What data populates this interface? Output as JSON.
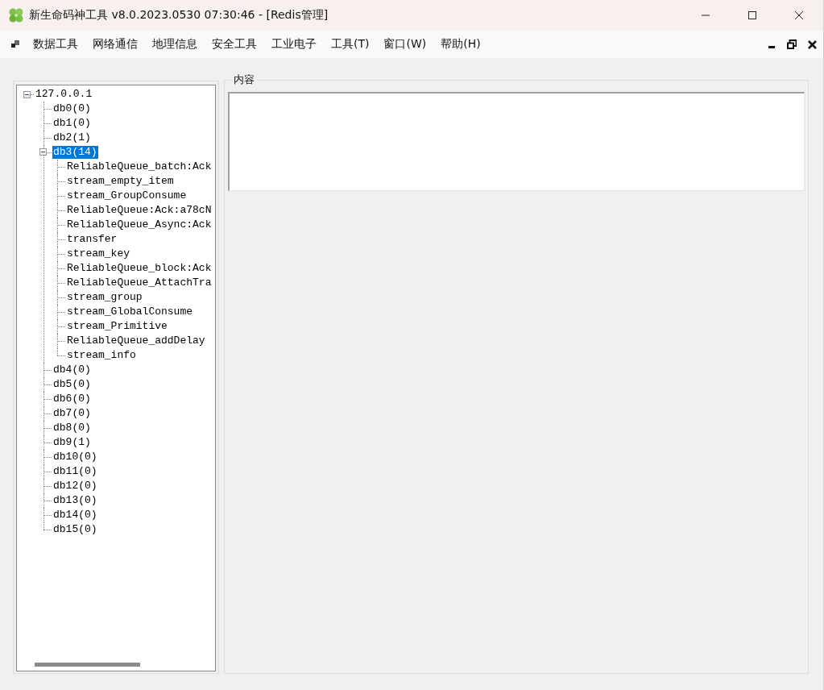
{
  "window": {
    "title": "新生命码神工具 v8.0.2023.0530 07:30:46 - [Redis管理]"
  },
  "menu": [
    "数据工具",
    "网络通信",
    "地理信息",
    "安全工具",
    "工业电子",
    "工具(T)",
    "窗口(W)",
    "帮助(H)"
  ],
  "tree": {
    "label": "127.0.0.1",
    "selected": false,
    "expanded": true,
    "children": [
      {
        "label": "db0(0)",
        "selected": false
      },
      {
        "label": "db1(0)",
        "selected": false
      },
      {
        "label": "db2(1)",
        "selected": false
      },
      {
        "label": "db3(14)",
        "selected": true,
        "expanded": true,
        "children": [
          {
            "label": "ReliableQueue_batch:Ack",
            "selected": false
          },
          {
            "label": "stream_empty_item",
            "selected": false
          },
          {
            "label": "stream_GroupConsume",
            "selected": false
          },
          {
            "label": "ReliableQueue:Ack:a78cN",
            "selected": false
          },
          {
            "label": "ReliableQueue_Async:Ack",
            "selected": false
          },
          {
            "label": "transfer",
            "selected": false
          },
          {
            "label": "stream_key",
            "selected": false
          },
          {
            "label": "ReliableQueue_block:Ack",
            "selected": false
          },
          {
            "label": "ReliableQueue_AttachTra",
            "selected": false
          },
          {
            "label": "stream_group",
            "selected": false
          },
          {
            "label": "stream_GlobalConsume",
            "selected": false
          },
          {
            "label": "stream_Primitive",
            "selected": false
          },
          {
            "label": "ReliableQueue_addDelay",
            "selected": false
          },
          {
            "label": "stream_info",
            "selected": false
          }
        ]
      },
      {
        "label": "db4(0)",
        "selected": false
      },
      {
        "label": "db5(0)",
        "selected": false
      },
      {
        "label": "db6(0)",
        "selected": false
      },
      {
        "label": "db7(0)",
        "selected": false
      },
      {
        "label": "db8(0)",
        "selected": false
      },
      {
        "label": "db9(1)",
        "selected": false
      },
      {
        "label": "db10(0)",
        "selected": false
      },
      {
        "label": "db11(0)",
        "selected": false
      },
      {
        "label": "db12(0)",
        "selected": false
      },
      {
        "label": "db13(0)",
        "selected": false
      },
      {
        "label": "db14(0)",
        "selected": false
      },
      {
        "label": "db15(0)",
        "selected": false
      }
    ]
  },
  "content": {
    "legend": "内容"
  }
}
